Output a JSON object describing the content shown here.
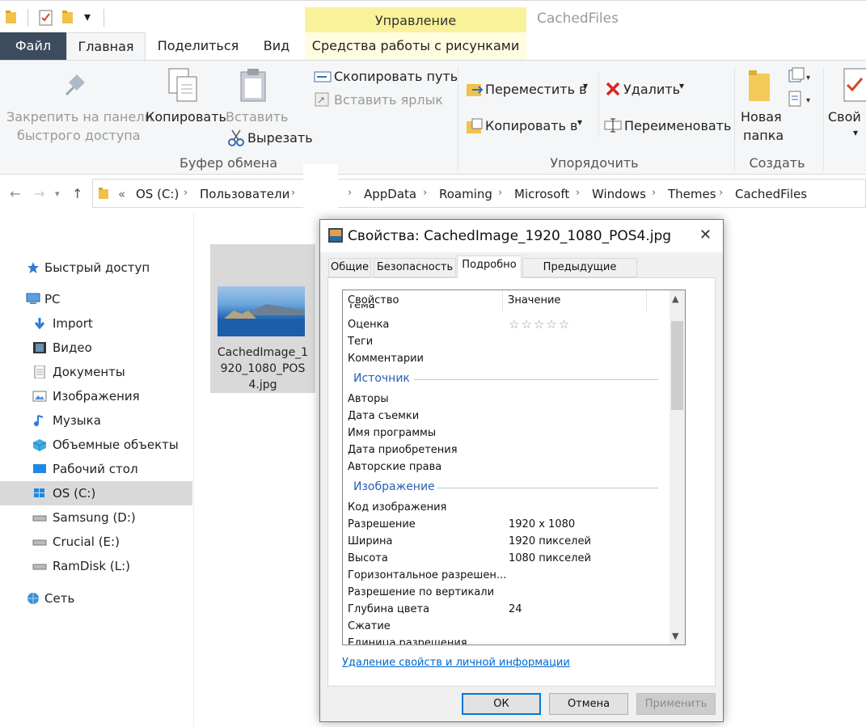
{
  "quick_access_toolbar": {
    "customize_arrow": "▾"
  },
  "title_bar": {
    "manage_band": "Управление",
    "app_title": "CachedFiles"
  },
  "tabs": {
    "file": "Файл",
    "home": "Главная",
    "share": "Поделиться",
    "view": "Вид",
    "picture_tools": "Средства работы с рисунками"
  },
  "ribbon": {
    "pin_line1": "Закрепить на панели",
    "pin_line2": "быстрого доступа",
    "copy": "Копировать",
    "paste": "Вставить",
    "copy_path": "Скопировать путь",
    "paste_shortcut": "Вставить ярлык",
    "cut": "Вырезать",
    "clipboard_group": "Буфер обмена",
    "move_to": "Переместить в",
    "copy_to": "Копировать в",
    "delete": "Удалить",
    "rename": "Переименовать",
    "organize_group": "Упорядочить",
    "new_folder_line1": "Новая",
    "new_folder_line2": "папка",
    "create_group": "Создать",
    "properties_partial": "Свой"
  },
  "address_bar": {
    "root_chevron": "«",
    "crumbs": [
      "OS (C:)",
      "Пользователи",
      "",
      "AppData",
      "Roaming",
      "Microsoft",
      "Windows",
      "Themes",
      "CachedFiles"
    ]
  },
  "nav": {
    "items": [
      {
        "label": "Быстрый доступ"
      },
      {
        "label": "PC"
      },
      {
        "label": "Import"
      },
      {
        "label": "Видео"
      },
      {
        "label": "Документы"
      },
      {
        "label": "Изображения"
      },
      {
        "label": "Музыка"
      },
      {
        "label": "Объемные объекты"
      },
      {
        "label": "Рабочий стол"
      },
      {
        "label": "OS (C:)"
      },
      {
        "label": "Samsung (D:)"
      },
      {
        "label": "Crucial (E:)"
      },
      {
        "label": "RamDisk (L:)"
      },
      {
        "label": "Сеть"
      }
    ],
    "selected": "OS (C:)"
  },
  "file": {
    "name": "CachedImage_1920_1080_POS4.jpg"
  },
  "dialog": {
    "title": "Свойства: CachedImage_1920_1080_POS4.jpg",
    "close": "✕",
    "tabs": [
      "Общие",
      "Безопасность",
      "Подробно",
      "Предыдущие версии"
    ],
    "active_tab": "Подробно",
    "columns": {
      "property": "Свойство",
      "value": "Значение"
    },
    "partial_top": "Тема",
    "rows_a": [
      {
        "k": "Оценка",
        "v": "☆☆☆☆☆"
      },
      {
        "k": "Теги",
        "v": ""
      },
      {
        "k": "Комментарии",
        "v": ""
      }
    ],
    "section_source": "Источник",
    "rows_b": [
      {
        "k": "Авторы",
        "v": ""
      },
      {
        "k": "Дата съемки",
        "v": ""
      },
      {
        "k": "Имя программы",
        "v": ""
      },
      {
        "k": "Дата приобретения",
        "v": ""
      },
      {
        "k": "Авторские права",
        "v": ""
      }
    ],
    "section_image": "Изображение",
    "rows_c": [
      {
        "k": "Код изображения",
        "v": ""
      },
      {
        "k": "Разрешение",
        "v": "1920 x 1080"
      },
      {
        "k": "Ширина",
        "v": "1920 пикселей"
      },
      {
        "k": "Высота",
        "v": "1080 пикселей"
      },
      {
        "k": "Горизонтальное разрешен...",
        "v": ""
      },
      {
        "k": "Разрешение по вертикали",
        "v": ""
      },
      {
        "k": "Глубина цвета",
        "v": "24"
      },
      {
        "k": "Сжатие",
        "v": ""
      }
    ],
    "partial_bottom": "Единица разрешения",
    "remove_link": "Удаление свойств и личной информации",
    "ok": "ОК",
    "cancel": "Отмена",
    "apply": "Применить"
  }
}
